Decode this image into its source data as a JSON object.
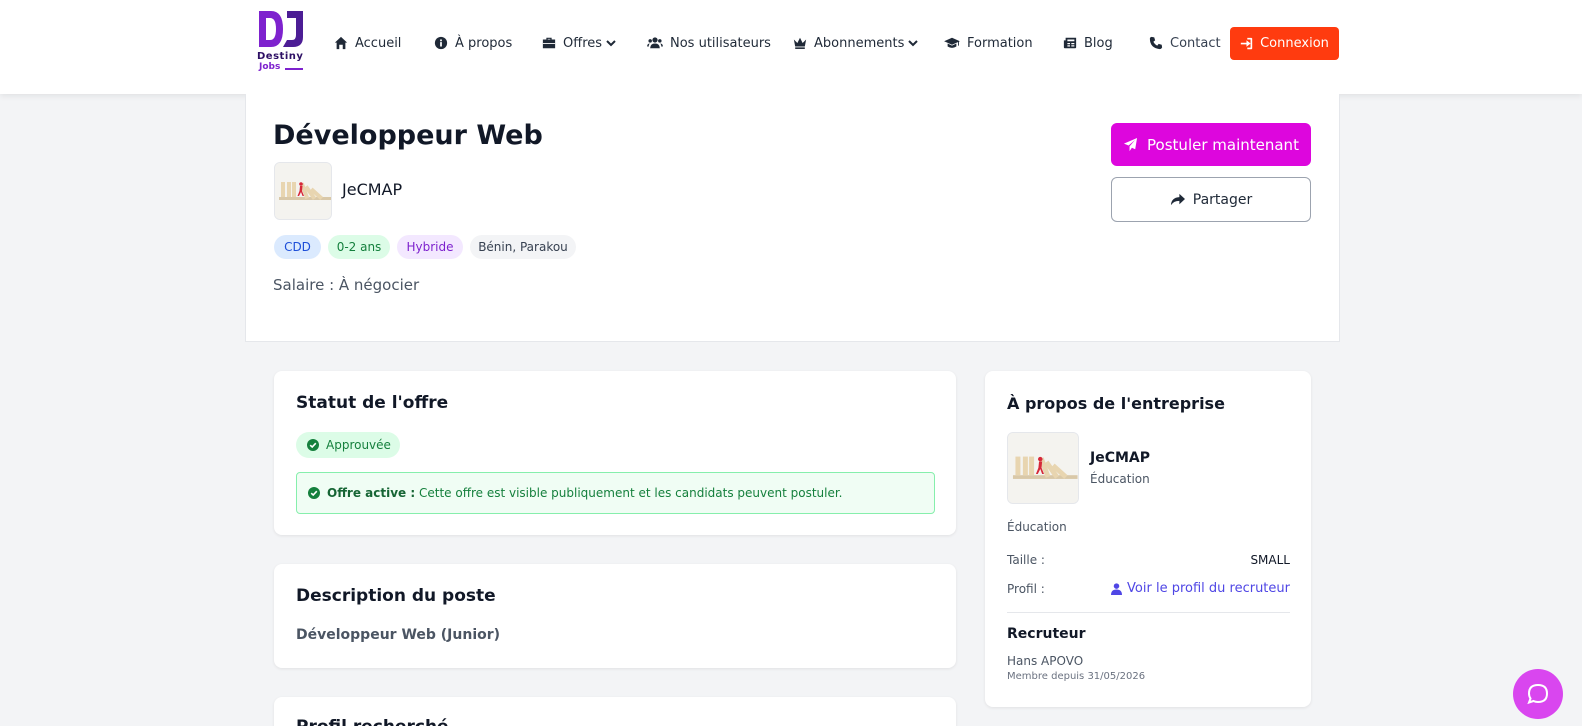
{
  "brand": {
    "line1": "Destiny",
    "line2": "Jobs",
    "primary": "#7e22ce"
  },
  "nav": {
    "items": [
      {
        "label": "Accueil",
        "icon": "home-icon"
      },
      {
        "label": "À propos",
        "icon": "info-icon"
      },
      {
        "label": "Offres",
        "icon": "briefcase-icon",
        "dropdown": true
      },
      {
        "label": "Nos utilisateurs",
        "icon": "users-icon"
      },
      {
        "label": "Abonnements",
        "icon": "crown-icon",
        "dropdown": true
      },
      {
        "label": "Formation",
        "icon": "graduation-cap-icon"
      },
      {
        "label": "Blog",
        "icon": "newspaper-icon"
      },
      {
        "label": "Contact",
        "icon": "phone-icon"
      }
    ],
    "login_label": "Connexion",
    "login_color": "#ff3b0f"
  },
  "job": {
    "title": "Développeur Web",
    "company": "JeCMAP",
    "tags": [
      "CDD",
      "0-2 ans",
      "Hybride",
      "Bénin, Parakou"
    ],
    "salary": "Salaire : À négocier",
    "apply_label": "Postuler maintenant",
    "apply_color": "#dd06dd",
    "share_label": "Partager"
  },
  "status": {
    "title": "Statut de l'offre",
    "badge": "Approuvée",
    "active_strong": "Offre active :",
    "active_text": "Cette offre est visible publiquement et les candidats peuvent postuler."
  },
  "description": {
    "title": "Description du poste",
    "text": "Développeur Web (Junior)"
  },
  "next_section": {
    "title": "Profil recherché"
  },
  "about": {
    "title": "À propos de l'entreprise",
    "company": "JeCMAP",
    "sector": "Éducation",
    "sector_line": "Éducation",
    "size_label": "Taille :",
    "size_value": "SMALL",
    "profile_label": "Profil :",
    "profile_link": "Voir le profil du recruteur",
    "recruiter_title": "Recruteur",
    "recruiter_name": "Hans APOVO",
    "member_since": "Membre depuis 31/05/2026"
  }
}
